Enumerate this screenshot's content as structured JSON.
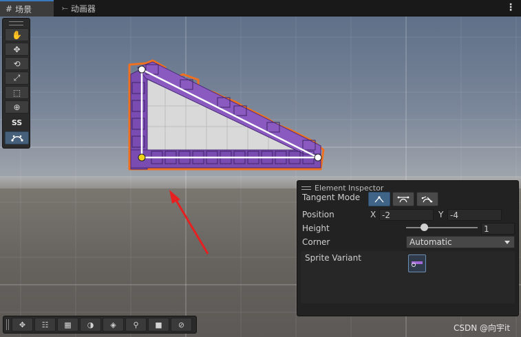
{
  "tabs": [
    {
      "label": "场景",
      "icon": "grid-icon",
      "active": true
    },
    {
      "label": "动画器",
      "icon": "animator-icon",
      "active": false
    }
  ],
  "tool_palette": {
    "tools": [
      "hand-tool",
      "move-tool",
      "rotate-tool",
      "scale-tool",
      "rect-tool",
      "transform-tool"
    ],
    "custom_label": "SS",
    "selected": "sprite-shape-edit-tool"
  },
  "bottom_toolbar": {
    "buttons": [
      "move-overlay",
      "align-overlay",
      "grid-snap-overlay",
      "shading-overlay",
      "layers-overlay",
      "search-overlay",
      "camera-overlay",
      "compass-overlay"
    ]
  },
  "inspector": {
    "title": "Element Inspector",
    "tangent_mode_label": "Tangent Mode",
    "tangent_modes": [
      "linear",
      "continuous",
      "broken"
    ],
    "tangent_mode_selected": "linear",
    "position_label": "Position",
    "x_label": "X",
    "x_value": "-2",
    "y_label": "Y",
    "y_value": "-4",
    "height_label": "Height",
    "height_value": "1",
    "height_slider_fraction": 0.25,
    "corner_label": "Corner",
    "corner_value": "Automatic",
    "sprite_variant_label": "Sprite Variant"
  },
  "watermark": "CSDN @向宇it",
  "colors": {
    "selection_outline": "#f07020",
    "brick_purple": "#7a4bb0",
    "selected_mode": "#3f6487",
    "tab_highlight": "#3a79bb",
    "arrow_red": "#e62020",
    "control_point_selected": "#f2d21a"
  }
}
